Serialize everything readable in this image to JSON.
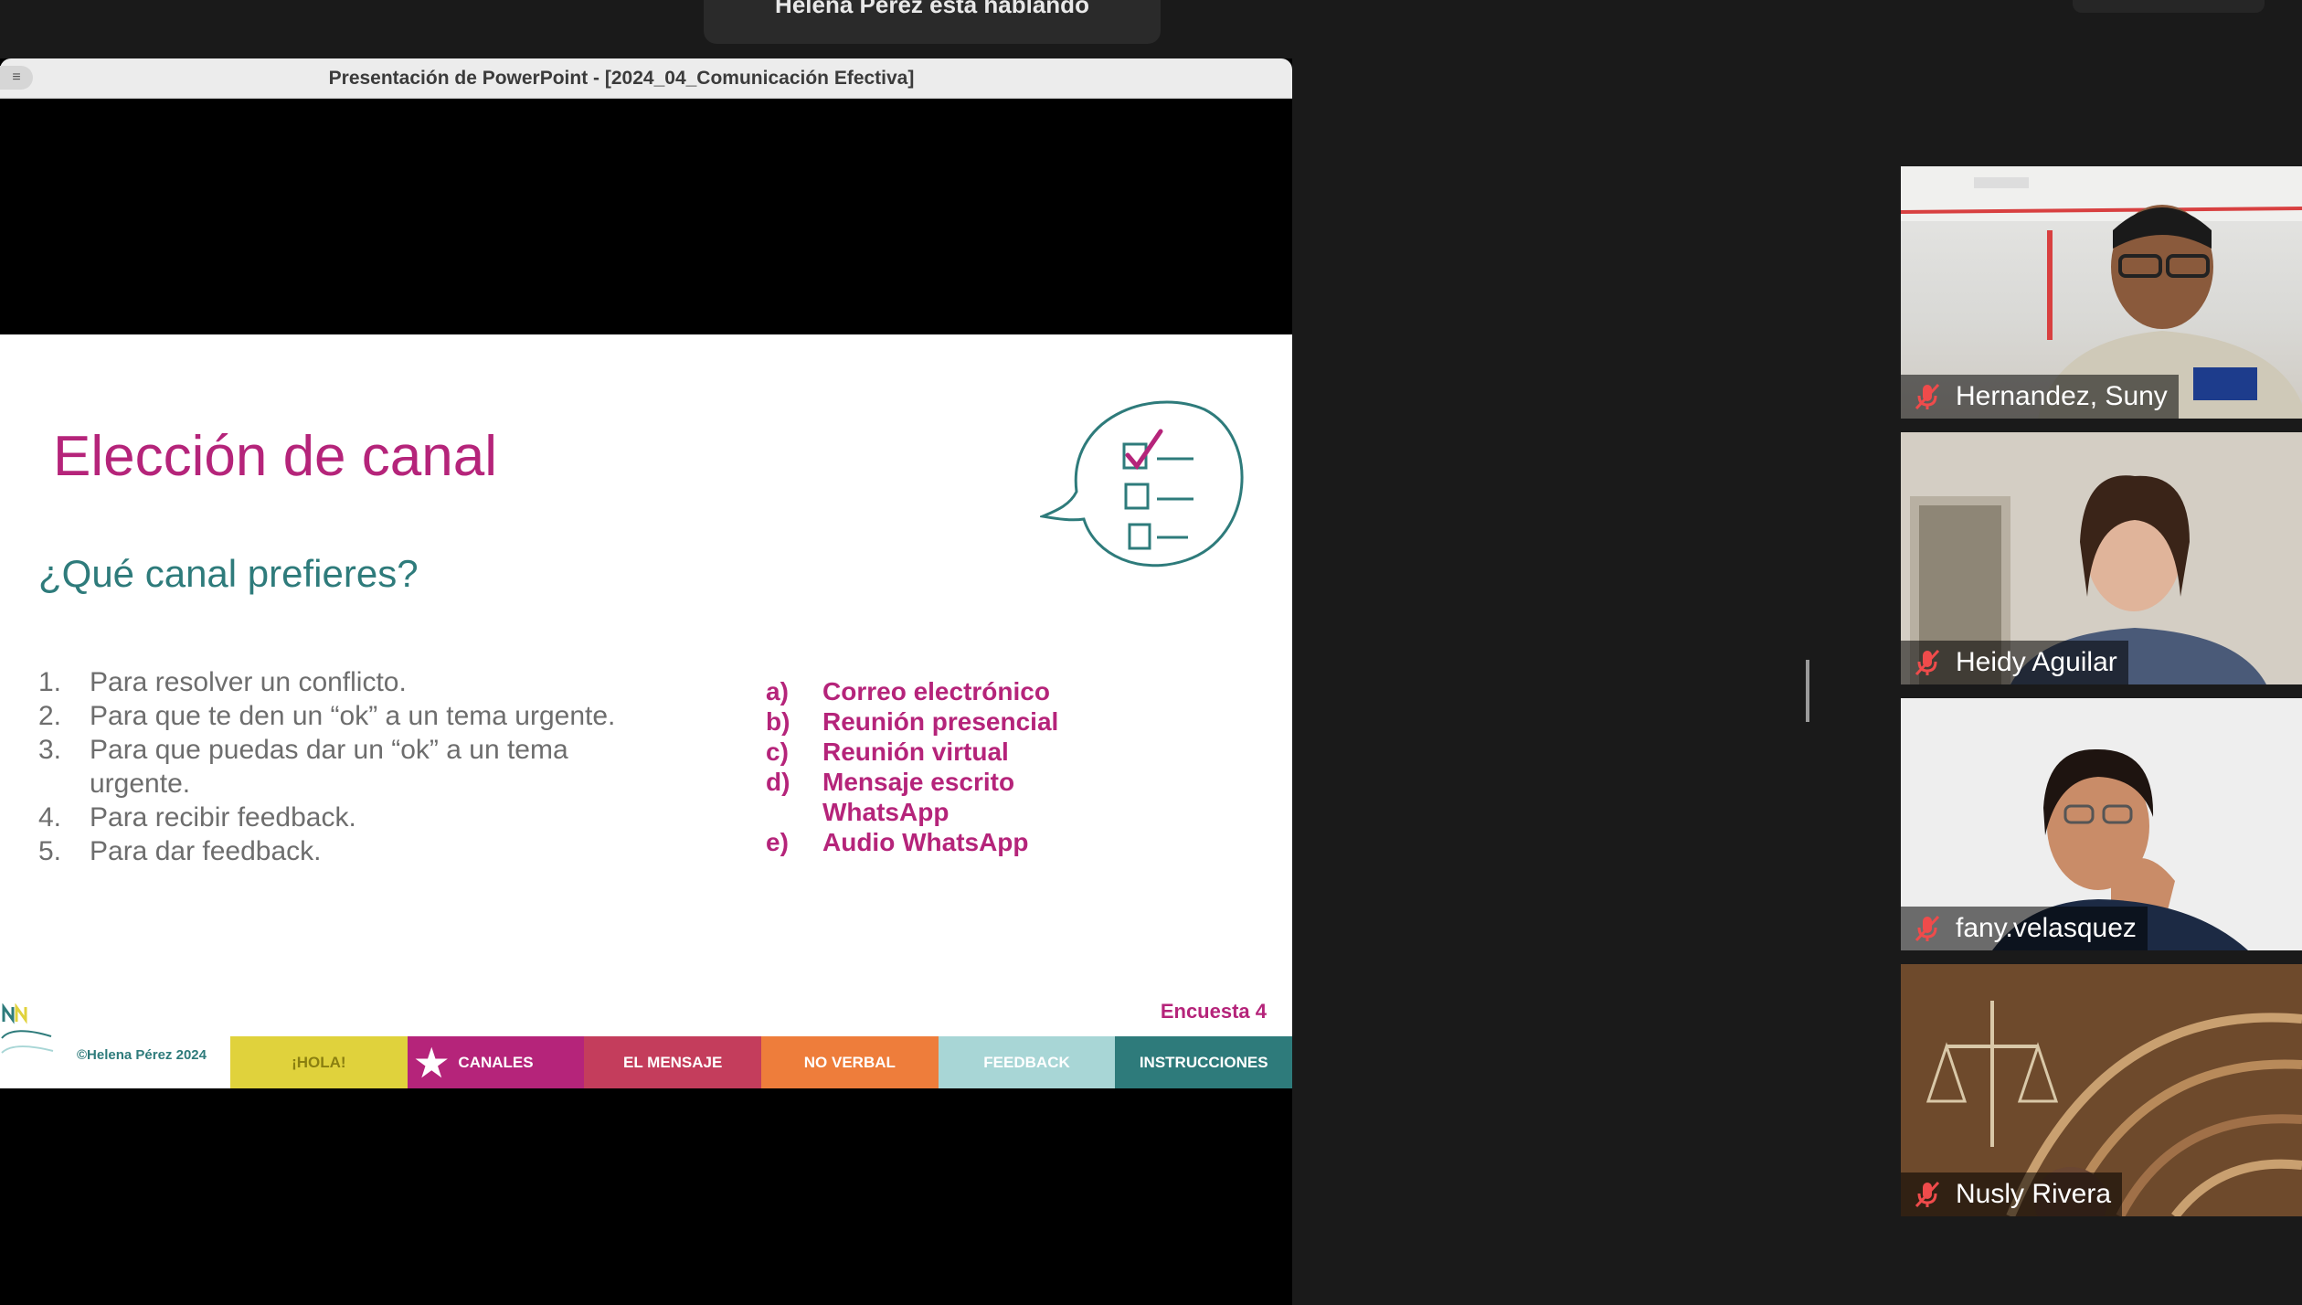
{
  "meeting": {
    "banner_text": "Helena Pérez está hablando",
    "layout_handle": "resize-handle"
  },
  "share_window": {
    "title": "Presentación de PowerPoint - [2024_04_Comunicación Efectiva]"
  },
  "slide": {
    "title": "Elección de canal",
    "subtitle": "¿Qué canal prefieres?",
    "questions": [
      {
        "num": "1.",
        "text": "Para resolver un conflicto."
      },
      {
        "num": "2.",
        "text": "Para que te den un “ok” a un tema urgente."
      },
      {
        "num": "3.",
        "text": "Para que puedas dar un “ok” a un tema urgente."
      },
      {
        "num": "4.",
        "text": "Para recibir feedback."
      },
      {
        "num": "5.",
        "text": "Para dar feedback."
      }
    ],
    "options": [
      {
        "letter": "a)",
        "text": "Correo electrónico"
      },
      {
        "letter": "b)",
        "text": "Reunión presencial"
      },
      {
        "letter": "c)",
        "text": "Reunión virtual"
      },
      {
        "letter": "d)",
        "text": "Mensaje escrito WhatsApp"
      },
      {
        "letter": "e)",
        "text": "Audio WhatsApp"
      }
    ],
    "survey_tag": "Encuesta 4",
    "copyright": "©Helena Pérez 2024",
    "icon": "checklist-speech-bubble-icon",
    "colors": {
      "title": "#b5247a",
      "subtitle": "#2e7b7b",
      "options": "#b5247a"
    },
    "nav_tabs": [
      {
        "label": "¡HOLA!",
        "color": "#e0d23c",
        "text_color": "#8a7f10"
      },
      {
        "label": "CANALES",
        "color": "#b5247a",
        "text_color": "#ffffff",
        "active": true
      },
      {
        "label": "EL MENSAJE",
        "color": "#c43d5c",
        "text_color": "#ffffff"
      },
      {
        "label": "NO VERBAL",
        "color": "#ee7d3b",
        "text_color": "#ffffff"
      },
      {
        "label": "FEEDBACK",
        "color": "#a8d6d6",
        "text_color": "#ffffff"
      },
      {
        "label": "INSTRUCCIONES",
        "color": "#2e7b7b",
        "text_color": "#ffffff"
      }
    ]
  },
  "participants": [
    {
      "name": "Hernandez, Suny",
      "muted": true,
      "icon": "mic-muted-icon"
    },
    {
      "name": "Heidy Aguilar",
      "muted": true,
      "icon": "mic-muted-icon"
    },
    {
      "name": "fany.velasquez",
      "muted": true,
      "icon": "mic-muted-icon"
    },
    {
      "name": "Nusly Rivera",
      "muted": true,
      "icon": "mic-muted-icon"
    }
  ]
}
